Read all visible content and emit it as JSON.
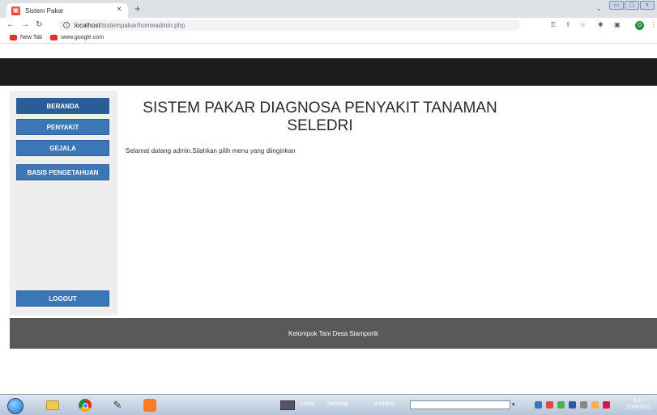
{
  "browser": {
    "tab_title": "Sistem Pakar",
    "tab_close": "×",
    "new_tab": "+",
    "url_host": "localhost",
    "url_path": "/sistempakar/homeadmin.php",
    "bookmarks": [
      {
        "label": "New Tab",
        "icon": "tab-icon"
      },
      {
        "label": "www.google.com",
        "icon": "google-icon"
      }
    ],
    "profile_initial": "D",
    "icons": [
      "back-icon",
      "forward-icon",
      "reload-icon",
      "info-icon",
      "key-icon",
      "share-icon",
      "star-icon",
      "extensions-icon",
      "sidepanel-icon",
      "menu-icon"
    ]
  },
  "page": {
    "title_line1": "SISTEM PAKAR DIAGNOSA PENYAKIT TANAMAN",
    "title_line2": "SELEDRI",
    "welcome": "Selamat datang admin.Silahkan pilih menu yang diinginkan",
    "menu": [
      {
        "label": "BERANDA"
      },
      {
        "label": "PENYAKIT"
      },
      {
        "label": "GEJALA"
      },
      {
        "label": "BASIS PENGETAHUAN"
      }
    ],
    "logout": "LOGOUT",
    "footer": "Kelompok Tani Desa Siamporik",
    "colors": {
      "topbar": "#1d1d1d",
      "button": "#3b76b6",
      "footer": "#595959",
      "sidebar": "#eeeeee"
    }
  },
  "taskbar": {
    "links": "Links",
    "desktop": "Desktop",
    "address": "Address",
    "time": "8:37",
    "date": "27/06/2021"
  }
}
